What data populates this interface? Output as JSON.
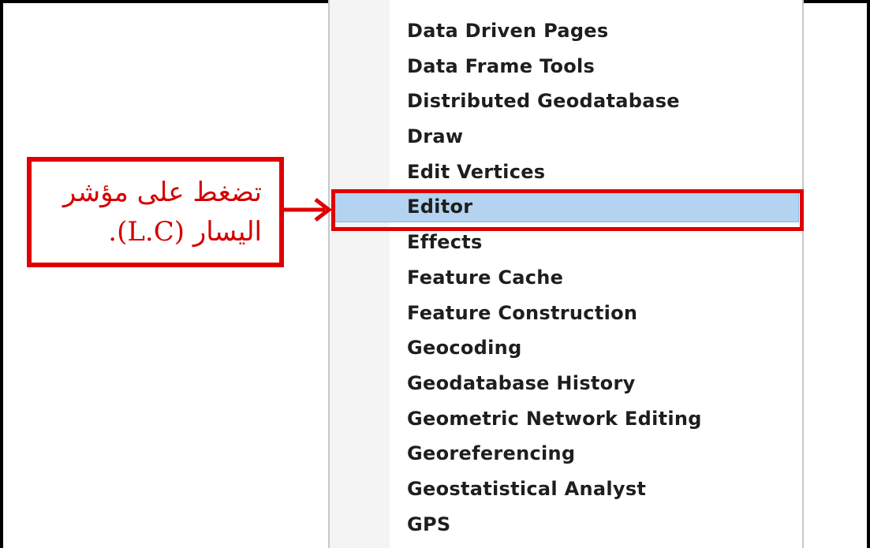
{
  "menu": {
    "items": [
      {
        "label": "Data Driven Pages",
        "selected": false
      },
      {
        "label": "Data Frame Tools",
        "selected": false
      },
      {
        "label": "Distributed Geodatabase",
        "selected": false
      },
      {
        "label": "Draw",
        "selected": false
      },
      {
        "label": "Edit Vertices",
        "selected": false
      },
      {
        "label": "Editor",
        "selected": true
      },
      {
        "label": "Effects",
        "selected": false
      },
      {
        "label": "Feature Cache",
        "selected": false
      },
      {
        "label": "Feature Construction",
        "selected": false
      },
      {
        "label": "Geocoding",
        "selected": false
      },
      {
        "label": "Geodatabase History",
        "selected": false
      },
      {
        "label": "Geometric Network Editing",
        "selected": false
      },
      {
        "label": "Georeferencing",
        "selected": false
      },
      {
        "label": "Geostatistical Analyst",
        "selected": false
      },
      {
        "label": "GPS",
        "selected": false
      }
    ]
  },
  "callout": {
    "line1": "تضغط على مؤشر",
    "line2": "اليسار (L.C)."
  },
  "colors": {
    "annotation": "#e00000",
    "selection": "#b3d3f0"
  },
  "icons": {
    "pointer": "arrow-right-icon"
  }
}
